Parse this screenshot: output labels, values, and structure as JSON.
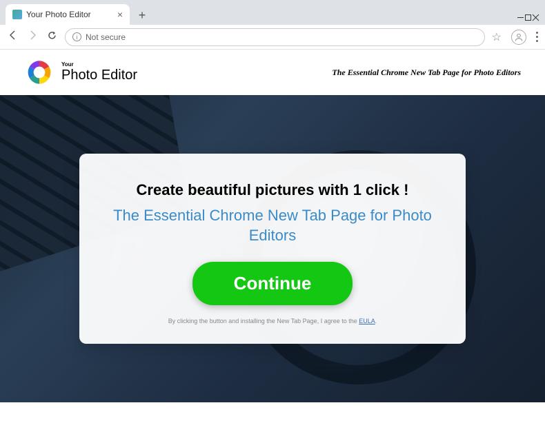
{
  "window": {
    "tab_title": "Your Photo Editor"
  },
  "addressbar": {
    "security_text": "Not secure"
  },
  "header": {
    "logo_small": "Your",
    "logo_big": "Photo Editor",
    "tagline": "The Essential Chrome New Tab Page for Photo Editors"
  },
  "card": {
    "title": "Create beautiful pictures with 1 click !",
    "subtitle": "The Essential Chrome New Tab Page for Photo Editors",
    "cta_label": "Continue",
    "disclaimer_pre": "By clicking the button and installing the New Tab Page, I agree to the ",
    "disclaimer_link": "EULA",
    "disclaimer_post": "."
  }
}
